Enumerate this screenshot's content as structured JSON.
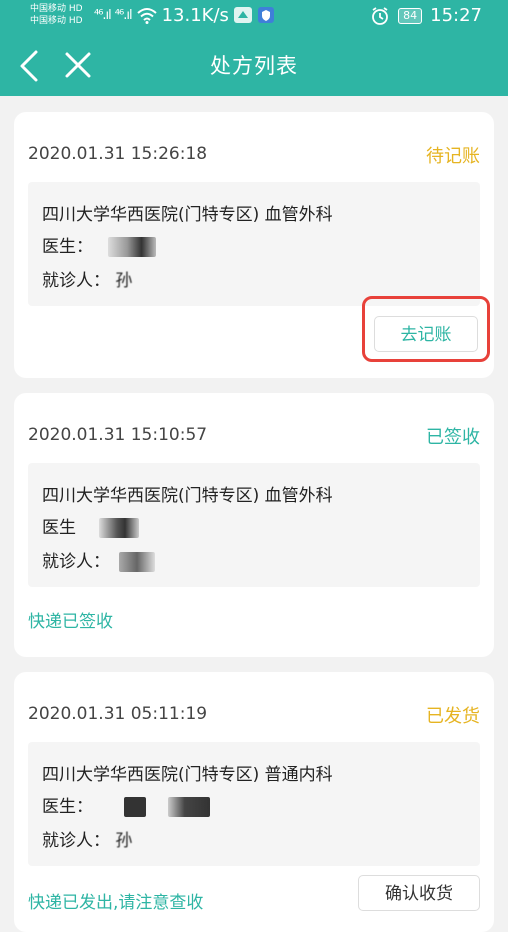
{
  "status_bar": {
    "carrier_1": "中国移动 HD",
    "carrier_2": "中国移动 HD",
    "signal_1": "⁴⁶.ıl",
    "signal_2": "⁴⁶.ıl",
    "speed": "13.1K/s",
    "battery": "84",
    "time": "15:27"
  },
  "header": {
    "title": "处方列表"
  },
  "colors": {
    "brand": "#2eb5a4",
    "pending": "#e6b422",
    "highlight": "#e8413a"
  },
  "cards": [
    {
      "datetime": "2020.01.31 15:26:18",
      "status": "待记账",
      "hospital": "四川大学华西医院(门特专区) 血管外科",
      "doctor_label": "医生：",
      "patient_label": "就诊人：",
      "patient_partial": "孙",
      "action_label": "去记账"
    },
    {
      "datetime": "2020.01.31 15:10:57",
      "status": "已签收",
      "hospital": "四川大学华西医院(门特专区) 血管外科",
      "doctor_label": "医生",
      "patient_label": "就诊人：",
      "note": "快递已签收"
    },
    {
      "datetime": "2020.01.31 05:11:19",
      "status": "已发货",
      "hospital": "四川大学华西医院(门特专区) 普通内科",
      "doctor_label": "医生：",
      "patient_label": "就诊人：",
      "patient_partial": "孙",
      "note": "快递已发出,请注意查收",
      "action_label": "确认收货"
    }
  ]
}
